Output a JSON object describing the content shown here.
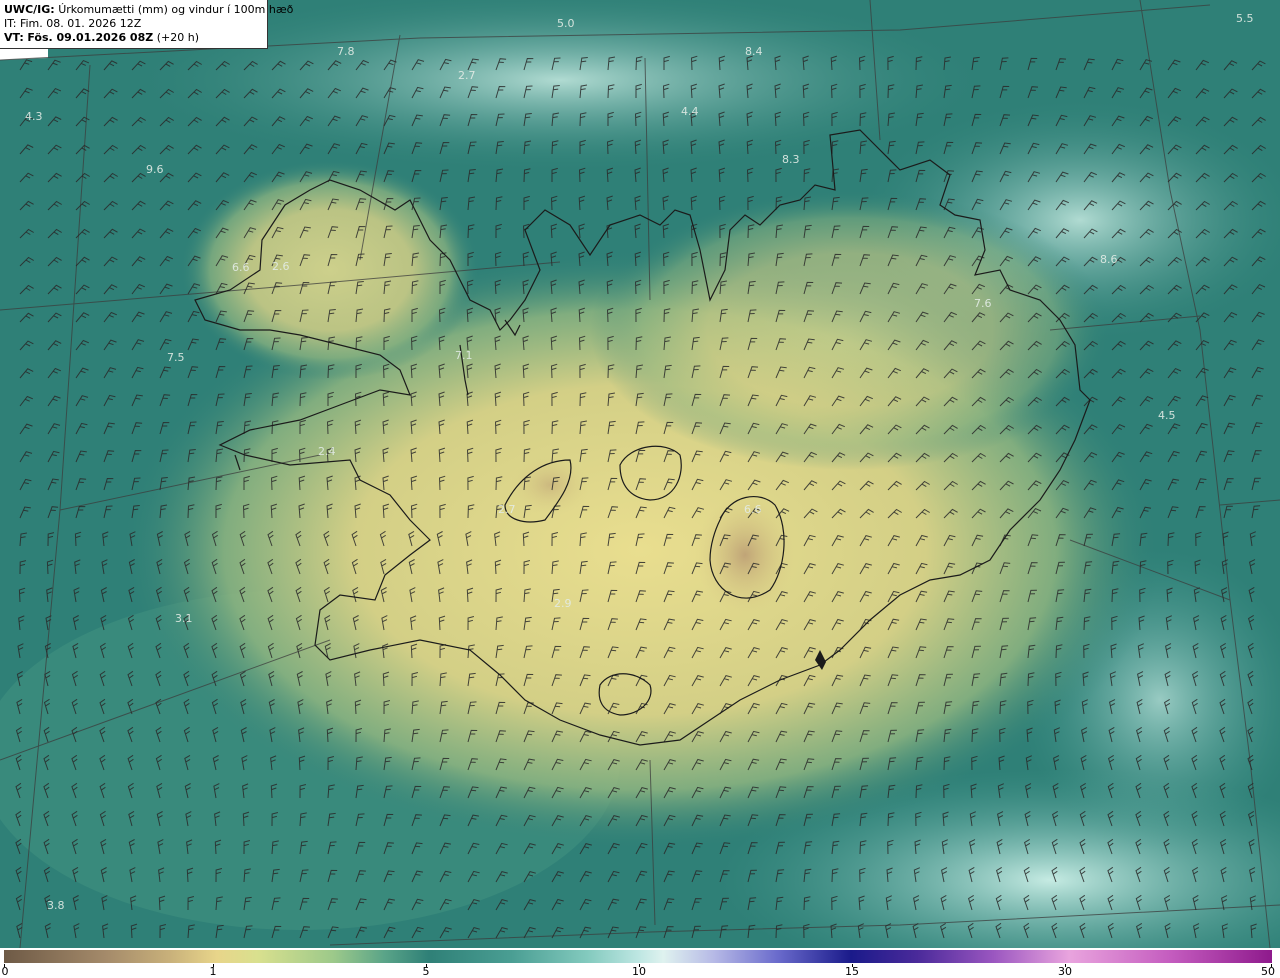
{
  "header": {
    "model": "UWC/IG:",
    "title": "Úrkomumætti (mm) og vindur í 100m hæð",
    "issue_time": "IT: Fim. 08. 01. 2026 12Z",
    "valid_prefix": "VT:",
    "valid_time": "Fös. 09.01.2026 08Z",
    "lead_time": "(+20 h)"
  },
  "map_labels": [
    {
      "text": "5.0"
    },
    {
      "text": "5.5"
    },
    {
      "text": "7.8"
    },
    {
      "text": "8.4"
    },
    {
      "text": "2.7"
    },
    {
      "text": "4.4"
    },
    {
      "text": "4.3"
    },
    {
      "text": "9.6"
    },
    {
      "text": "8.3"
    },
    {
      "text": "6.6"
    },
    {
      "text": "2.6"
    },
    {
      "text": "8.6"
    },
    {
      "text": "7.6"
    },
    {
      "text": "7.5"
    },
    {
      "text": "7.1"
    },
    {
      "text": "4.5"
    },
    {
      "text": "2.4"
    },
    {
      "text": "2.7"
    },
    {
      "text": "6.6"
    },
    {
      "text": "3.1"
    },
    {
      "text": "2.9"
    },
    {
      "text": "3.8"
    }
  ],
  "colorbar": {
    "unit": "mm",
    "ticks": [
      {
        "label": "0",
        "value": 0
      },
      {
        "label": "1",
        "value": 1
      },
      {
        "label": "5",
        "value": 5
      },
      {
        "label": "10",
        "value": 10
      },
      {
        "label": "15",
        "value": 15
      },
      {
        "label": "30",
        "value": 30
      },
      {
        "label": "50",
        "value": 50
      }
    ]
  },
  "colors": {
    "ocean_teal": "#2f8077",
    "land_yellow": "#e4d98c",
    "coast": "#1b1b1b",
    "wind_barb": "#2a2a2a",
    "grid": "#3c3c3c"
  }
}
